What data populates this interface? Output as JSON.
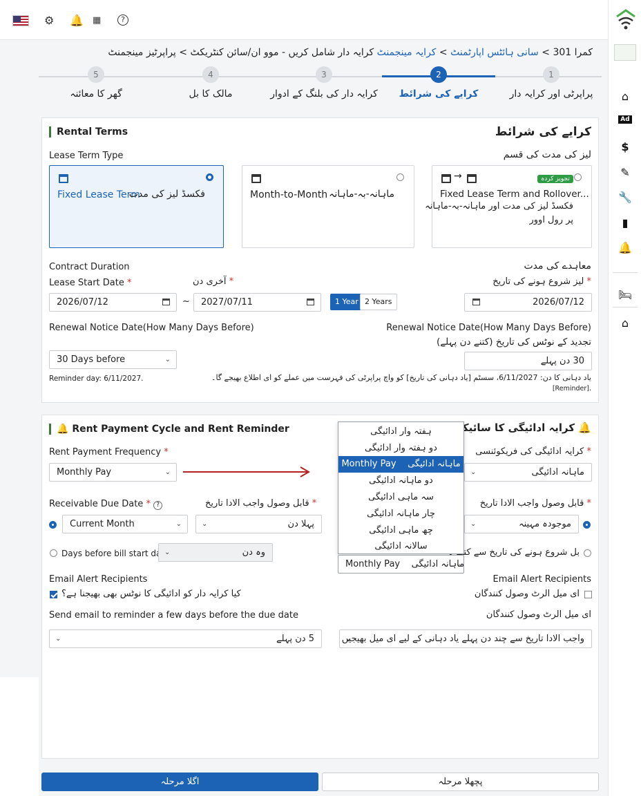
{
  "colors": {
    "primary": "#1d63b5",
    "accent_green": "#2e9b45",
    "arrow_red": "#b22222"
  },
  "topbar": {
    "icons": [
      "us-flag-icon",
      "gear-icon",
      "bell-icon",
      "calendar-icon",
      "help-icon"
    ]
  },
  "sidebar": {
    "icons": [
      "home-icon",
      "ad-icon",
      "dollar-icon",
      "edit-document-icon",
      "wrench-icon",
      "bar-chart-icon",
      "bell-icon",
      "bed-icon",
      "house-icon"
    ]
  },
  "breadcrumb": {
    "item1": "کمرا 301",
    "sep": ">",
    "item2": "سانی ہائٹس اپارٹمنٹ",
    "item3": "کرایہ مینجمنٹ",
    "item4": "کرایہ دار شامل کریں - موو ان/سائن کنٹریکٹ",
    "item5": "پراپرٹیز مینجمنٹ"
  },
  "steps": [
    {
      "num": "1",
      "label": "پراپرٹی اور کرایہ دار"
    },
    {
      "num": "2",
      "label": "کرایے کی شرائط"
    },
    {
      "num": "3",
      "label": "کرایہ دار کی بلنگ کے ادوار"
    },
    {
      "num": "4",
      "label": "مالک کا بل"
    },
    {
      "num": "5",
      "label": "گھر کا معائنہ"
    }
  ],
  "rental_terms": {
    "title_en": "Rental Terms",
    "title_ur": "کرایے کی شرائط",
    "lease_type_en": "Lease Term Type",
    "lease_type_ur": "لیز کی مدت کی قسم",
    "option1_en": "Fixed Lease Term",
    "option1_ur": "فکسڈ لیز کی مدت",
    "option2_en": "Month-to-Month",
    "option2_ur": "ماہانہ-بہ-ماہانہ",
    "option3_en": "Fixed Lease Term and Rollover...",
    "option3_ur_line1": "فکسڈ لیز کی مدت اور ماہانہ-بہ-ماہانہ",
    "option3_ur_line2": "پر رول اوور",
    "option3_badge": "تجویز کردہ",
    "contract_duration_en": "Contract Duration",
    "contract_duration_ur": "معاہدے کی مدت",
    "lease_start_en": "Lease Start Date",
    "end_date_ur": "آخری دن",
    "lease_start_ur": "لیز شروع ہونے کی تاریخ",
    "req": "*",
    "start_date": "2026/07/12",
    "end_date": "2027/07/11",
    "tilde": "~",
    "one_year": "1 Year",
    "two_years": "2 Years",
    "start_date_right": "2026/07/12",
    "renewal_en": "Renewal Notice Date(How Many Days Before)",
    "renewal_en_right": "Renewal Notice Date(How Many Days Before)",
    "renewal_ur": "تجدید کے نوٹس کی تاریخ (کتنے دن پہلے)",
    "renewal_select": "30 Days before",
    "renewal_input_ur": "30 دن پہلے",
    "reminder_en": "Reminder day: 6/11/2027.",
    "reminder_ur": "یاد دہانی کا دن: 6/11/2027، سسٹم [یاد دہانی کی تاریخ] کو واچ پراپرٹی کی فہرست میں عملے کو ای اطلاع بھیجے گا۔",
    "reminder_ur2": "[Reminder]."
  },
  "rent_cycle": {
    "title_en": "Rent Payment Cycle and Rent Reminder",
    "title_ur": "کرایہ ادائیگی کا سائیکل اور",
    "freq_en": "Rent Payment Frequency",
    "freq_ur": "کرایہ ادائیگی کی فریکوئنسی",
    "req": "*",
    "freq_value": "Monthly Pay",
    "freq_value_ur": "ماہانہ ادائیگی",
    "due_en": "Receivable Due Date",
    "due_ur": "قابل وصول واجب الادا تاریخ",
    "due_ur_right": "قابل وصول واجب الادا تاریخ",
    "current_month": "Current Month",
    "first_day_ur": "پہلا دن",
    "current_month_ur": "موجودہ مہینہ",
    "days_before_en": "Days before bill start date:",
    "days_before_value_ur": "وہ دن",
    "days_before_ur": "بل شروع ہونے کی تاریخ سے کتنے د",
    "email_en": "Email Alert Recipients",
    "email_en_right": "Email Alert Recipients",
    "notify_tenant_ur": "کیا کرایہ دار کو ادائیگی کا نوٹس بھی بھیجنا ہے؟",
    "email_recipients_ur": "ای میل الرٹ وصول کنندگان",
    "email_recipients_ur2": "ای میل الرٹ وصول کنندگان",
    "send_email_en": "Send email to reminder a few days before the due date",
    "send_email_select_ur": "5 دن پہلے",
    "send_email_right_ur": "واجب الادا تاریخ سے چند دن پہلے یاد دہانی کے لیے ای میل بھیجیں",
    "bottom_select_en": "Monthly Pay",
    "bottom_select_ur": "ماہانہ ادائیگی"
  },
  "dropdown": {
    "items": [
      {
        "label": "ہفتہ وار ادائیگی"
      },
      {
        "label": "دو ہفتہ وار ادائیگی"
      },
      {
        "label": "ماہانہ ادائیگی",
        "label_en": "Monthly Pay"
      },
      {
        "label": "دو ماہانہ ادائیگی"
      },
      {
        "label": "سہ ماہی ادائیگی"
      },
      {
        "label": "چار ماہانہ ادائیگی"
      },
      {
        "label": "چھ ماہی ادائیگی"
      },
      {
        "label": "سالانہ ادائیگی"
      }
    ]
  },
  "footer": {
    "next": "اگلا مرحلہ",
    "prev": "پچھلا مرحلہ"
  }
}
